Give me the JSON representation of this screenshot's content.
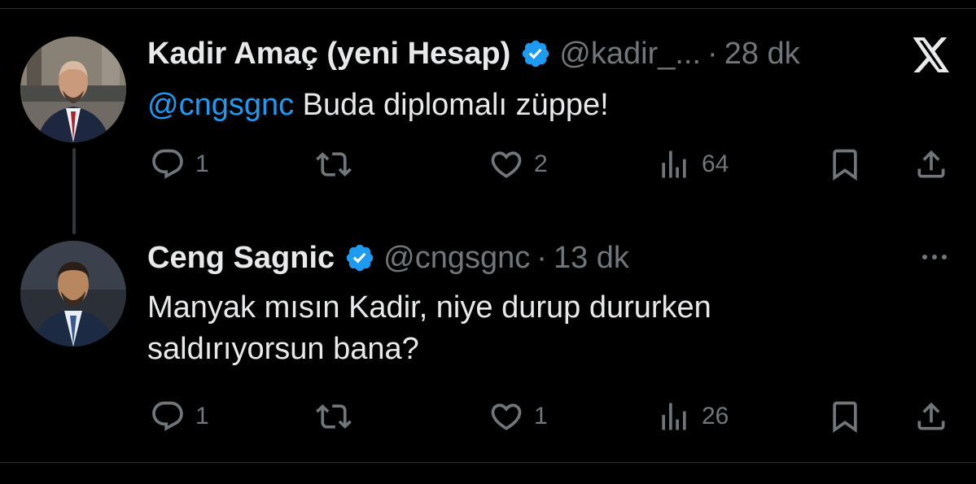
{
  "colors": {
    "background": "#000000",
    "text": "#e7e9ea",
    "muted": "#71767b",
    "accent": "#1d9bf0",
    "verified_badge": "#1d9bf0",
    "divider": "#2f3336"
  },
  "logo": {
    "icon": "x-logo-icon"
  },
  "tweets": [
    {
      "author": {
        "name": "Kadir Amaç (yeni Hesap)",
        "handle": "@kadir_...",
        "verified": true,
        "avatar_icon": "avatar-photo"
      },
      "separator": "·",
      "time": "28 dk",
      "body": {
        "mention": "@cngsgnc",
        "text": " Buda diplomalı züppe!"
      },
      "actions": {
        "reply": {
          "icon": "reply-icon",
          "count": "1"
        },
        "repost": {
          "icon": "repost-icon",
          "count": ""
        },
        "like": {
          "icon": "heart-icon",
          "count": "2"
        },
        "views": {
          "icon": "views-icon",
          "count": "64"
        },
        "bookmark": {
          "icon": "bookmark-icon"
        },
        "share": {
          "icon": "share-icon"
        }
      }
    },
    {
      "author": {
        "name": "Ceng Sagnic",
        "handle": "@cngsgnc",
        "verified": true,
        "avatar_icon": "avatar-photo"
      },
      "separator": "·",
      "time": "13 dk",
      "body": {
        "line1": "Manyak mısın Kadir, niye durup dururken",
        "line2": "saldırıyorsun bana?"
      },
      "more_icon": "more-horizontal-icon",
      "actions": {
        "reply": {
          "icon": "reply-icon",
          "count": "1"
        },
        "repost": {
          "icon": "repost-icon",
          "count": ""
        },
        "like": {
          "icon": "heart-icon",
          "count": "1"
        },
        "views": {
          "icon": "views-icon",
          "count": "26"
        },
        "bookmark": {
          "icon": "bookmark-icon"
        },
        "share": {
          "icon": "share-icon"
        }
      }
    }
  ]
}
